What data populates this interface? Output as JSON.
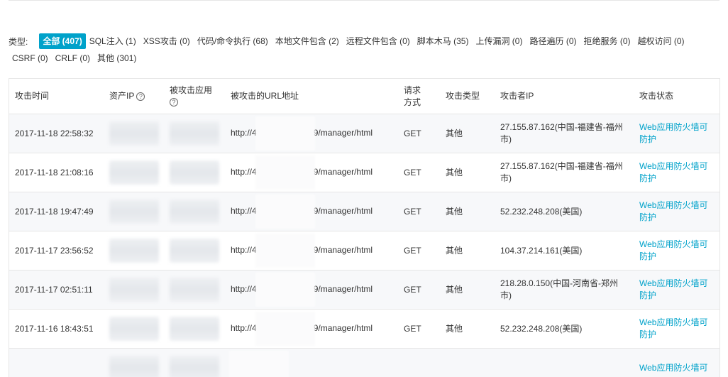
{
  "filters": {
    "label": "类型:",
    "row1": [
      {
        "label": "全部 (407)",
        "active": true
      },
      {
        "label": "SQL注入 (1)"
      },
      {
        "label": "XSS攻击 (0)"
      },
      {
        "label": "代码/命令执行 (68)"
      },
      {
        "label": "本地文件包含 (2)"
      },
      {
        "label": "远程文件包含 (0)"
      },
      {
        "label": "脚本木马 (35)"
      },
      {
        "label": "上传漏洞 (0)"
      },
      {
        "label": "路径遍历 (0)"
      },
      {
        "label": "拒绝服务 (0)"
      },
      {
        "label": "越权访问 (0)"
      }
    ],
    "row2": [
      {
        "label": "CSRF (0)"
      },
      {
        "label": "CRLF (0)"
      },
      {
        "label": "其他 (301)"
      }
    ]
  },
  "table": {
    "headers": {
      "time": "攻击时间",
      "asset_ip": "资产IP",
      "app": "被攻击应用",
      "url": "被攻击的URL地址",
      "method": "请求方式",
      "type": "攻击类型",
      "attacker": "攻击者IP",
      "status": "攻击状态",
      "help": "?"
    },
    "rows": [
      {
        "time": "2017-11-18 22:58:32",
        "url_prefix": "http://4",
        "url_suffix": "9/manager/html",
        "method": "GET",
        "type": "其他",
        "attacker": "27.155.87.162(中国-福建省-福州市)",
        "status": "Web应用防火墙可防护"
      },
      {
        "time": "2017-11-18 21:08:16",
        "url_prefix": "http://4",
        "url_suffix": "9/manager/html",
        "method": "GET",
        "type": "其他",
        "attacker": "27.155.87.162(中国-福建省-福州市)",
        "status": "Web应用防火墙可防护"
      },
      {
        "time": "2017-11-18 19:47:49",
        "url_prefix": "http://4",
        "url_suffix": "9/manager/html",
        "method": "GET",
        "type": "其他",
        "attacker": "52.232.248.208(美国)",
        "status": "Web应用防火墙可防护"
      },
      {
        "time": "2017-11-17 23:56:52",
        "url_prefix": "http://4",
        "url_suffix": "9/manager/html",
        "method": "GET",
        "type": "其他",
        "attacker": "104.37.214.161(美国)",
        "status": "Web应用防火墙可防护"
      },
      {
        "time": "2017-11-17 02:51:11",
        "url_prefix": "http://4",
        "url_suffix": "9/manager/html",
        "method": "GET",
        "type": "其他",
        "attacker": "218.28.0.150(中国-河南省-郑州市)",
        "status": "Web应用防火墙可防护"
      },
      {
        "time": "2017-11-16 18:43:51",
        "url_prefix": "http://4",
        "url_suffix": "9/manager/html",
        "method": "GET",
        "type": "其他",
        "attacker": "52.232.248.208(美国)",
        "status": "Web应用防火墙可防护"
      },
      {
        "time": "",
        "url_prefix": "",
        "url_suffix": "",
        "method": "",
        "type": "",
        "attacker": "",
        "status": "Web应用防火墙可"
      }
    ]
  }
}
